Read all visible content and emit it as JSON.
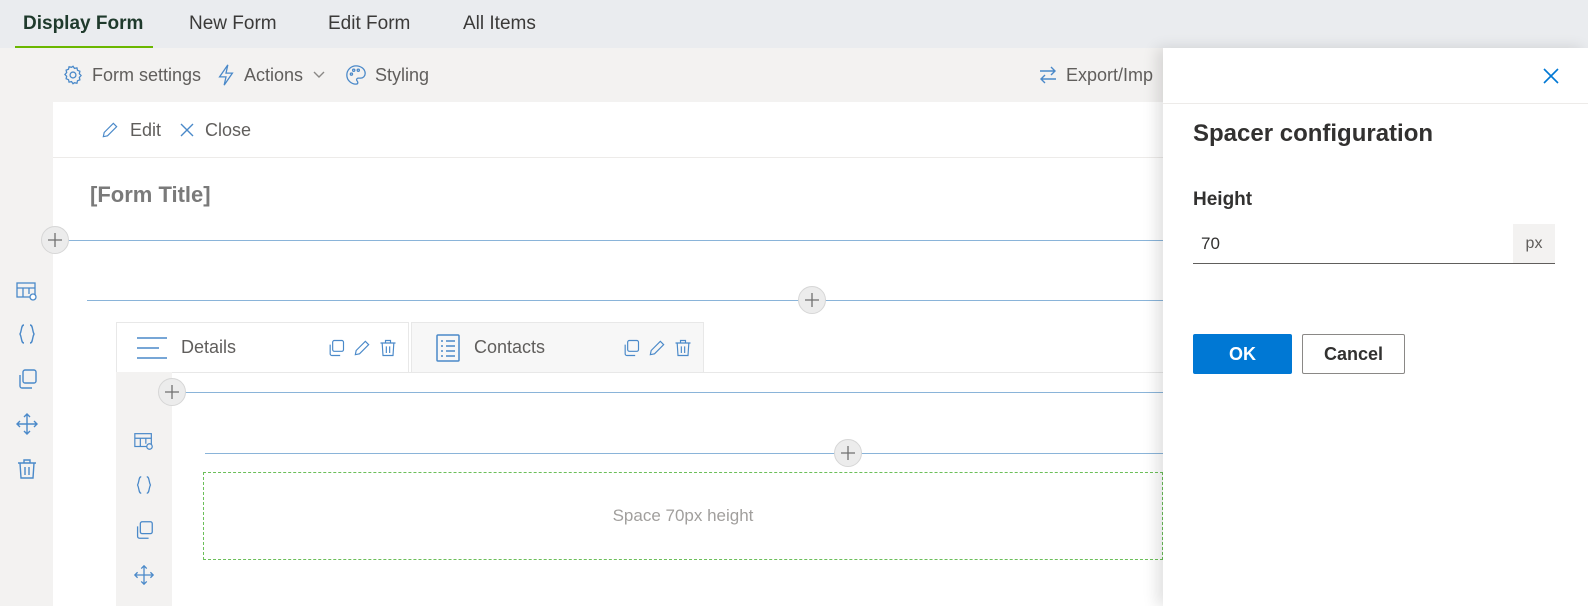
{
  "tabs": [
    {
      "label": "Display Form",
      "active": true
    },
    {
      "label": "New Form",
      "active": false
    },
    {
      "label": "Edit Form",
      "active": false
    },
    {
      "label": "All Items",
      "active": false
    }
  ],
  "toolbar": {
    "form_settings": "Form settings",
    "actions": "Actions",
    "styling": "Styling",
    "export_import": "Export/Imp"
  },
  "command_bar": {
    "edit": "Edit",
    "close": "Close"
  },
  "form": {
    "title": "[Form Title]",
    "tabs": [
      {
        "label": "Details",
        "active": true
      },
      {
        "label": "Contacts",
        "active": false
      }
    ],
    "spacer_text": "Space 70px height"
  },
  "panel": {
    "title": "Spacer configuration",
    "height_label": "Height",
    "height_value": "70",
    "unit": "px",
    "ok_label": "OK",
    "cancel_label": "Cancel"
  },
  "colors": {
    "accent": "#0078d4",
    "active_tab_underline": "#6bb700",
    "spacer_border": "#6bbf59",
    "icon_blue": "#4a89c9"
  }
}
